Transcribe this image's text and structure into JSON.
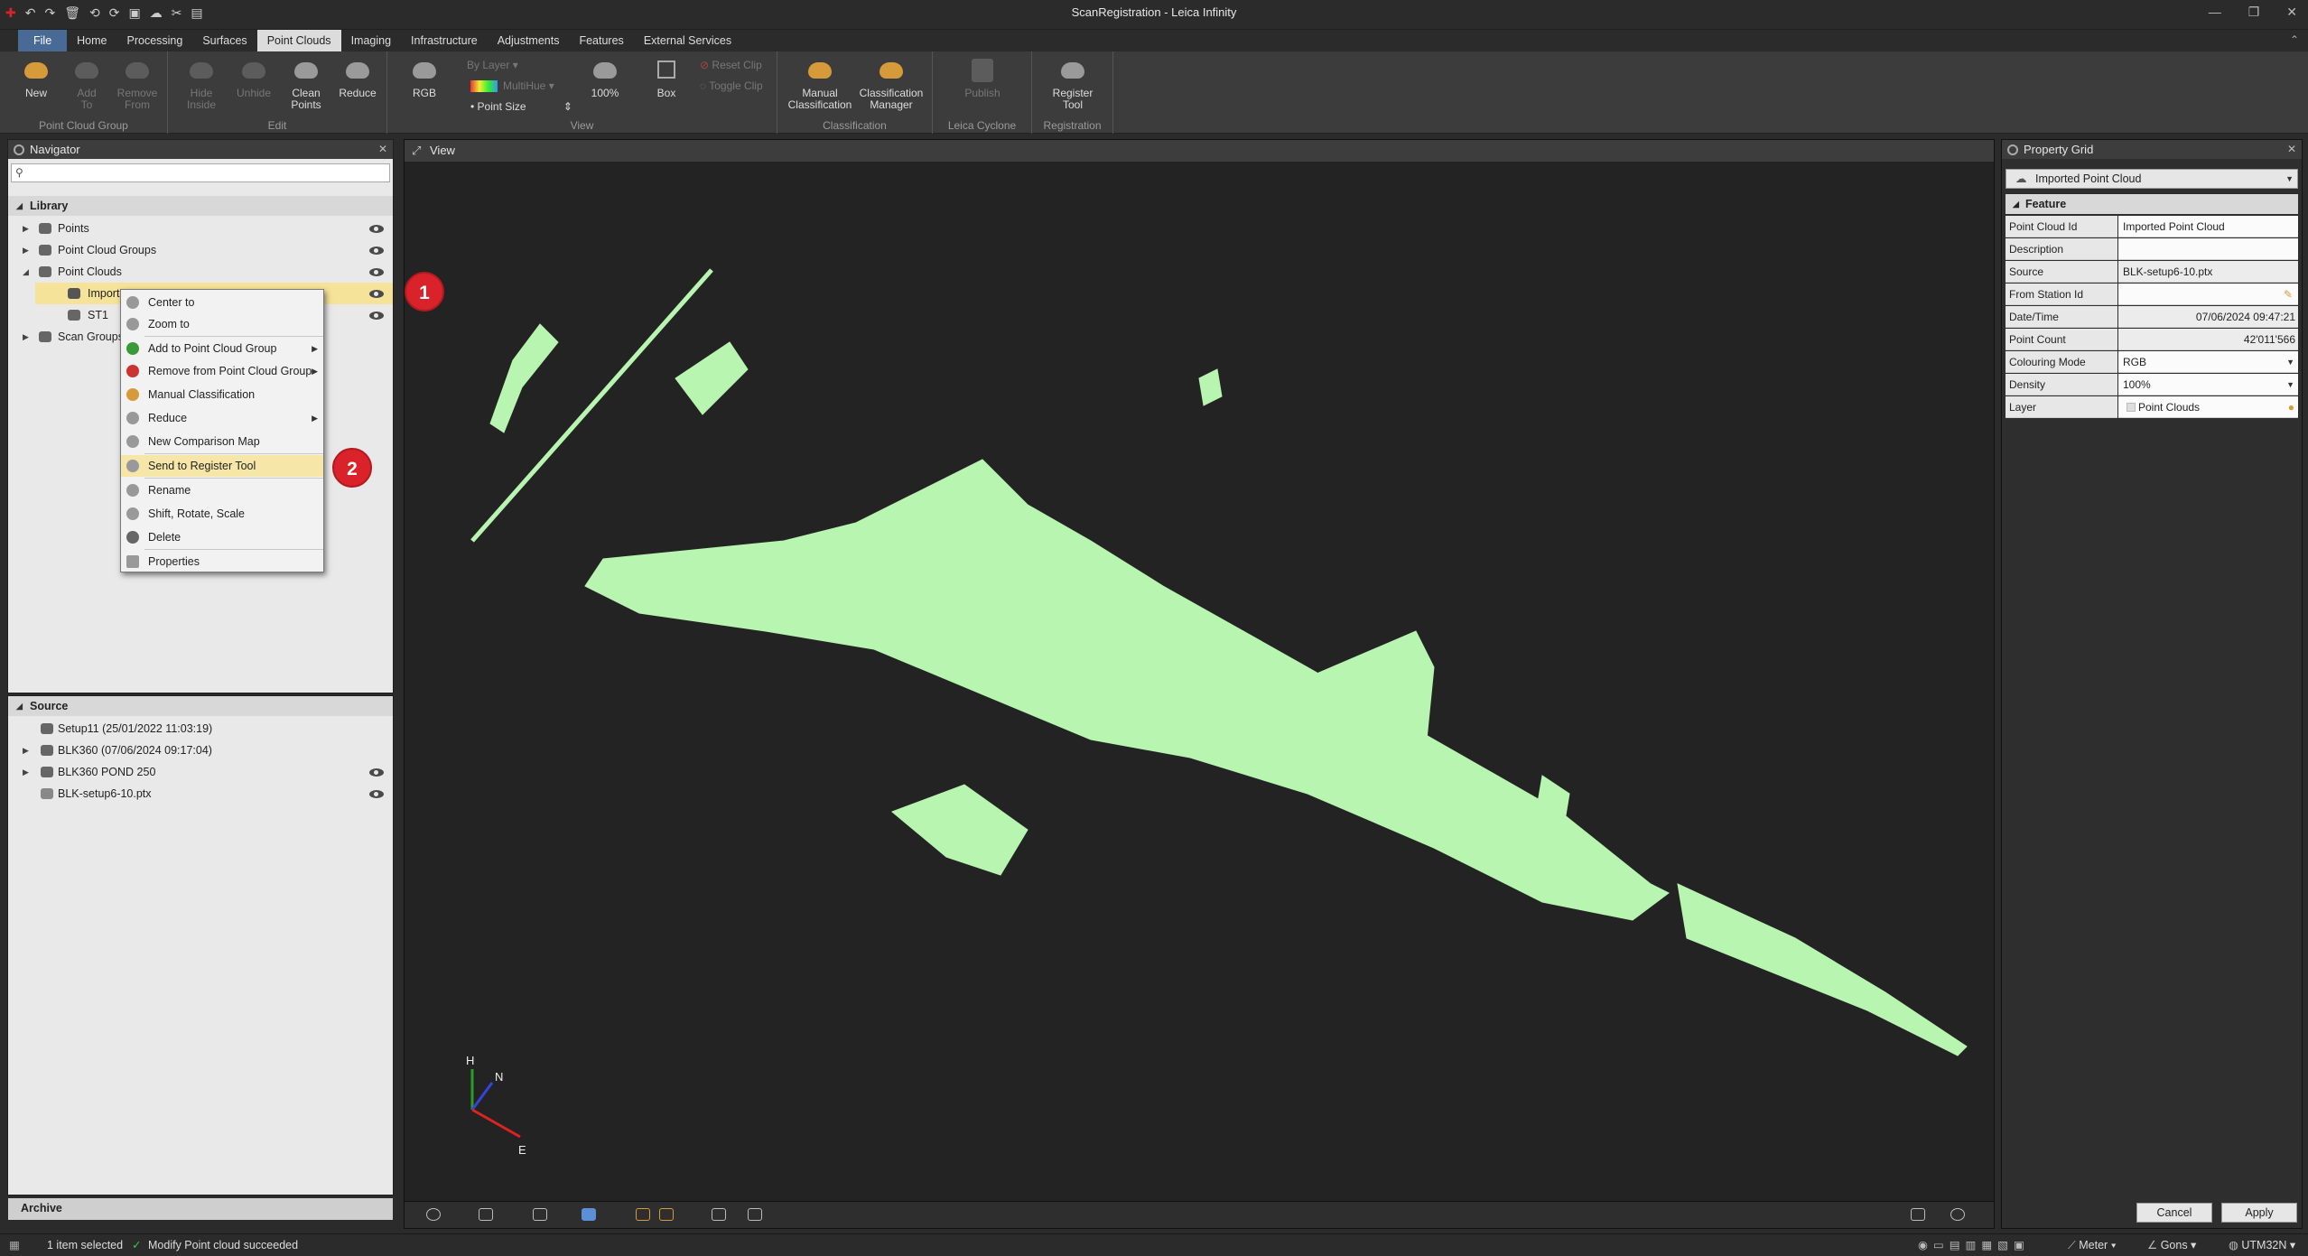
{
  "window": {
    "title": "ScanRegistration - Leica Infinity"
  },
  "menu": {
    "tabs": [
      "File",
      "Home",
      "Processing",
      "Surfaces",
      "Point Clouds",
      "Imaging",
      "Infrastructure",
      "Adjustments",
      "Features",
      "External Services"
    ],
    "active": "Point Clouds"
  },
  "ribbon": {
    "pcg": {
      "new": "New",
      "add1": "Add",
      "add2": "To",
      "rem1": "Remove",
      "rem2": "From",
      "label": "Point Cloud Group"
    },
    "edit": {
      "hide1": "Hide",
      "hide2": "Inside",
      "unhide": "Unhide",
      "clean1": "Clean",
      "clean2": "Points",
      "reduce": "Reduce",
      "label": "Edit"
    },
    "view": {
      "rgb": "RGB",
      "bylayer": "By Layer",
      "multihue": "MultiHue",
      "pointsize": "Point Size",
      "pct": "100%",
      "box": "Box",
      "resetclip": "Reset Clip",
      "toggleclip": "Toggle Clip",
      "label": "View"
    },
    "classification": {
      "manual1": "Manual",
      "manual2": "Classification",
      "mgr1": "Classification",
      "mgr2": "Manager",
      "label": "Classification"
    },
    "cyclone": {
      "publish": "Publish",
      "label": "Leica Cyclone"
    },
    "registration": {
      "reg1": "Register",
      "reg2": "Tool",
      "label": "Registration"
    }
  },
  "navigator": {
    "title": "Navigator",
    "library_label": "Library",
    "tree": [
      {
        "label": "Points"
      },
      {
        "label": "Point Cloud Groups"
      },
      {
        "label": "Point Clouds"
      },
      {
        "label": "Importe"
      },
      {
        "label": "ST1"
      },
      {
        "label": "Scan Groups"
      }
    ],
    "source_label": "Source",
    "source": [
      {
        "label": "Setup11 (25/01/2022 11:03:19)"
      },
      {
        "label": "BLK360 (07/06/2024 09:17:04)"
      },
      {
        "label": "BLK360  POND 250"
      },
      {
        "label": "BLK-setup6-10.ptx"
      }
    ],
    "archive_label": "Archive"
  },
  "context_menu": [
    "Center to",
    "Zoom to",
    "Add to Point Cloud Group",
    "Remove from Point Cloud Group",
    "Manual Classification",
    "Reduce",
    "New Comparison Map",
    "Send to Register Tool",
    "Rename",
    "Shift, Rotate, Scale",
    "Delete",
    "Properties"
  ],
  "view": {
    "title": "View",
    "axes": {
      "h": "H",
      "n": "N",
      "e": "E"
    },
    "cloud_color": "#b7f5b0"
  },
  "badges": [
    "1",
    "2"
  ],
  "property_grid": {
    "title": "Property Grid",
    "selector": "Imported Point Cloud",
    "section": "Feature",
    "rows": [
      {
        "k": "Point Cloud Id",
        "v": "Imported Point Cloud"
      },
      {
        "k": "Description",
        "v": ""
      },
      {
        "k": "Source",
        "v": "BLK-setup6-10.ptx"
      },
      {
        "k": "From Station Id",
        "v": ""
      },
      {
        "k": "Date/Time",
        "v": "07/06/2024 09:47:21"
      },
      {
        "k": "Point Count",
        "v": "42'011'566"
      },
      {
        "k": "Colouring Mode",
        "v": "RGB"
      },
      {
        "k": "Density",
        "v": "100%"
      },
      {
        "k": "Layer",
        "v": "Point Clouds"
      }
    ],
    "cancel": "Cancel",
    "apply": "Apply"
  },
  "status": {
    "selected": "1 item selected",
    "message": "Modify Point cloud succeeded",
    "units": "Meter",
    "angle": "Gons",
    "crs": "UTM32N"
  },
  "colors": {
    "accent": "#4a6a96",
    "highlight": "#f6e39a",
    "badge": "#d9222a"
  }
}
